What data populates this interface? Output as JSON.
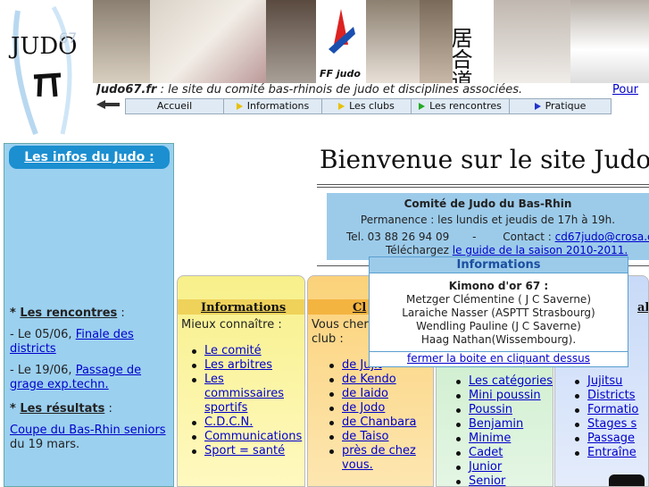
{
  "header": {
    "logo_text": "JUDO",
    "logo_num": "67",
    "banner_ffjudo": "FF judo",
    "banner_kanji": "居合道",
    "tagline_site": "Judo67.fr",
    "tagline_desc": " : le site du comité bas-rhinois de judo et disciplines associées.",
    "tagline_pour": "Pour"
  },
  "menu": [
    {
      "label": "Accueil",
      "tri": ""
    },
    {
      "label": "Informations",
      "tri": "#e8c000"
    },
    {
      "label": "Les clubs",
      "tri": "#e8c000"
    },
    {
      "label": "Les rencontres",
      "tri": "#22aa22"
    },
    {
      "label": "Pratique",
      "tri": "#2233cc"
    }
  ],
  "left": {
    "title": "Les infos du Judo :",
    "rencontres_head": "Les rencontres",
    "r1_prefix": "- Le 05/06, ",
    "r1_link": "Finale des districts",
    "r2_prefix": "- Le 19/06, ",
    "r2_link": "Passage de grage exp.techn.",
    "resultats_head": "Les résultats",
    "res_link": "Coupe du Bas-Rhin seniors",
    "res_suffix": "du 19 mars."
  },
  "main": {
    "welcome": "Bienvenue sur le site Judo",
    "comite_title": "Comité de Judo du Bas-Rhin",
    "permanence": "Permanence : les lundis et jeudis de 17h à 19h.",
    "tel": "Tel. 03 88 26 94 09",
    "contact_prefix": "Contact : ",
    "contact_email": "cd67judo@crosa.c",
    "guide_prefix": "Téléchargez ",
    "guide_link": "le guide de la saison 2010-2011."
  },
  "col_info": {
    "title": "Informations",
    "intro": "Mieux connaître :",
    "items": [
      "Le comité",
      "Les arbitres",
      "Les commissaires sportifs",
      "C.D.C.N.",
      "Communications",
      "Sport = santé"
    ]
  },
  "col_clubs": {
    "title": "Cl",
    "intro": "Vous cher club :",
    "items": [
      "de Jujit",
      "de Kendo",
      "de Iaido",
      "de Jodo",
      "de Chanbara",
      "de Taiso",
      "près de chez vous."
    ]
  },
  "col_cat": {
    "items": [
      "Les catégories",
      "Mini poussin",
      "Poussin",
      "Benjamin",
      "Minime",
      "Cadet",
      "Junior",
      "Senior"
    ]
  },
  "col_prat": {
    "title": "al",
    "items": [
      "Jujitsu",
      "Districts",
      "Formatio",
      "Stages s",
      "Passage",
      "Entraîne"
    ]
  },
  "popup": {
    "title": "Informations",
    "heading": "Kimono d'or 67 :",
    "lines": [
      "Metzger Clémentine ( J C Saverne)",
      "Laraiche Nasser (ASPTT Strasbourg)",
      "Wendling Pauline (J C Saverne)",
      "Haag Nathan(Wissembourg)."
    ],
    "close": "fermer la boite en cliquant dessus"
  }
}
